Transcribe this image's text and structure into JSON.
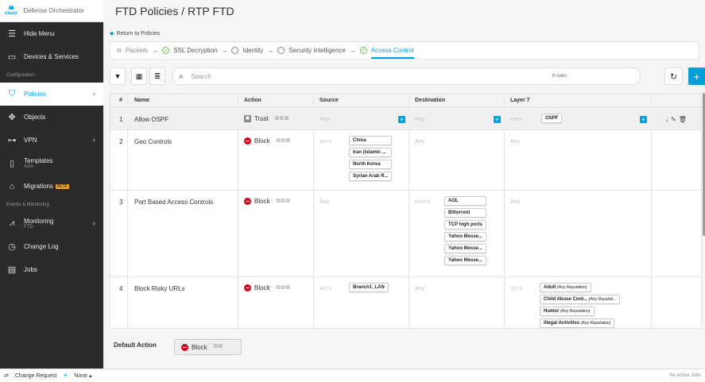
{
  "brand": {
    "logo_text": "cisco",
    "name": "Defense Orchestrator"
  },
  "sidebar": {
    "hide_menu": "Hide Menu",
    "devices": "Devices & Services",
    "section_config": "Configuration",
    "policies": "Policies",
    "objects": "Objects",
    "vpn": "VPN",
    "templates": "Templates",
    "templates_sub": "ASA",
    "migrations": "Migrations",
    "migrations_badge": "BETA",
    "section_events": "Events & Monitoring",
    "monitoring": "Monitoring",
    "monitoring_sub": "FTD",
    "change_log": "Change Log",
    "jobs": "Jobs"
  },
  "header": {
    "title": "FTD Policies  /  RTP FTD",
    "return_link": "Return to Policies"
  },
  "steps": {
    "packets": "Packets",
    "ssl": "SSL Decryption",
    "identity": "Identity",
    "security": "Security Intelligence",
    "access": "Access Control",
    "arrow": "→"
  },
  "toolbar": {
    "search_placeholder": "Search",
    "rule_count": "6 rules"
  },
  "table": {
    "headers": {
      "num": "#",
      "name": "Name",
      "action": "Action",
      "source": "Source",
      "destination": "Destination",
      "layer7": "Layer 7"
    },
    "any": "Any",
    "rows": [
      {
        "num": "1",
        "name": "Allow OSPF",
        "action": "Trust",
        "layer7_label": "APPS",
        "apps": [
          "OSPF"
        ]
      },
      {
        "num": "2",
        "name": "Geo Controls",
        "action": "Block",
        "src_label": "NETS",
        "src": [
          "China",
          "Iran (Islamic ...",
          "North Korea",
          "Syrian Arab R..."
        ]
      },
      {
        "num": "3",
        "name": "Port Based Access Controls",
        "action": "Block",
        "dst_label": "PORTS",
        "dst": [
          "AOL",
          "Bittorrent",
          "TCP high ports",
          "Yahoo Messe...",
          "Yahoo Messe...",
          "Yahoo Messe..."
        ]
      },
      {
        "num": "4",
        "name": "Block Risky URLs",
        "action": "Block",
        "src_label": "NETS",
        "src": [
          "Branch1_LAN"
        ],
        "layer7_label": "URLS",
        "urls": [
          {
            "name": "Adult",
            "rep": "(Any Reputation)"
          },
          {
            "name": "Child Abuse Cont...",
            "rep": "(Any Reputati..."
          },
          {
            "name": "Humor",
            "rep": "(Any Reputation)"
          },
          {
            "name": "Illegal Activities",
            "rep": "(Any Reputation)"
          }
        ]
      }
    ]
  },
  "default_action": {
    "label": "Default Action",
    "value": "Block"
  },
  "footer": {
    "change_request": "Change Request",
    "none": "None",
    "jobs": "No Active Jobs"
  },
  "colors": {
    "accent": "#049fd9",
    "block": "#d0021b",
    "sidebar": "#2b2b2b",
    "check": "#6bbd45"
  }
}
